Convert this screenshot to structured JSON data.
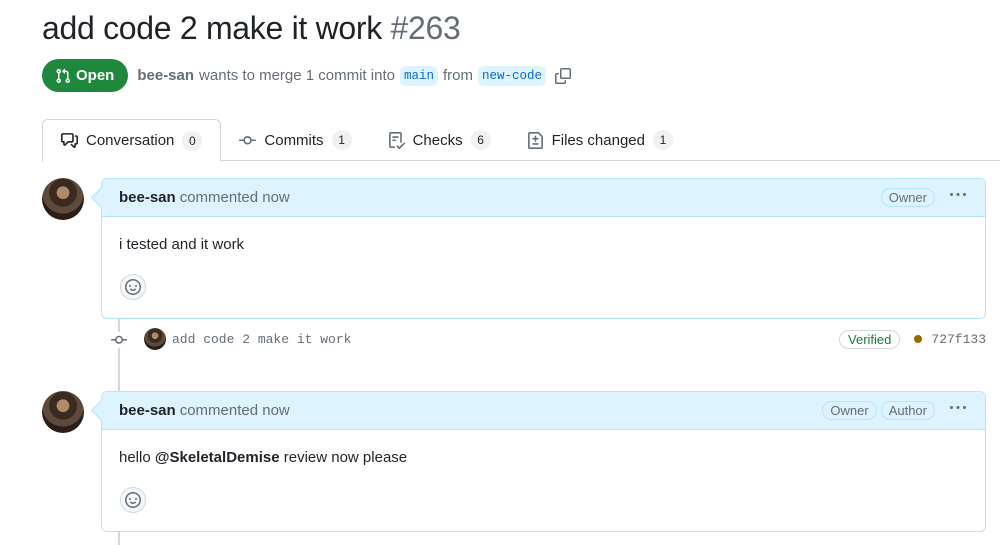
{
  "pr": {
    "title": "add code 2 make it work",
    "number": "#263",
    "state": "Open",
    "author": "bee-san",
    "merge_text": "wants to merge 1 commit into",
    "base_branch": "main",
    "from_text": "from",
    "head_branch": "new-code"
  },
  "tabs": [
    {
      "label": "Conversation",
      "count": "0",
      "icon": "comment-discussion-icon",
      "active": true
    },
    {
      "label": "Commits",
      "count": "1",
      "icon": "git-commit-icon"
    },
    {
      "label": "Checks",
      "count": "6",
      "icon": "checklist-icon"
    },
    {
      "label": "Files changed",
      "count": "1",
      "icon": "file-diff-icon"
    }
  ],
  "comments": [
    {
      "author": "bee-san",
      "action": "commented now",
      "roles": [
        "Owner"
      ],
      "body": "i tested and it work"
    },
    {
      "author": "bee-san",
      "action": "commented now",
      "roles": [
        "Owner",
        "Author"
      ],
      "body_prefix": "hello ",
      "mention": "@SkeletalDemise",
      "body_suffix": " review now please"
    }
  ],
  "commit": {
    "message": "add code 2 make it work",
    "verified_label": "Verified",
    "status_color": "#9a6700",
    "sha": "727f133"
  },
  "colors": {
    "open_green": "#1f883d",
    "link_blue": "#0969da",
    "header_blue": "#ddf4ff",
    "border_blue": "#b6e3ff"
  }
}
